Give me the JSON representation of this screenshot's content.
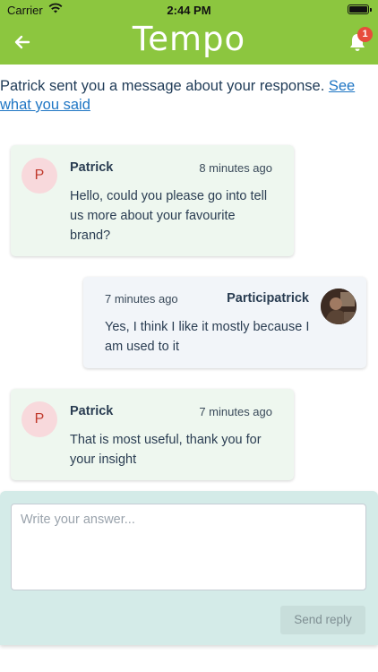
{
  "status_bar": {
    "carrier": "Carrier",
    "time": "2:44 PM"
  },
  "header": {
    "title": "Tempo",
    "notification_count": "1"
  },
  "notice": {
    "text": "Patrick sent you a message about your response. ",
    "link": "See what you said"
  },
  "messages": [
    {
      "initial": "P",
      "sender": "Patrick",
      "time": "8 minutes ago",
      "body": "Hello, could you please go into tell us more about your favourite brand?"
    },
    {
      "sender": "Participatrick",
      "time": "7 minutes ago",
      "body": "Yes, I think I like it mostly because I am used to it"
    },
    {
      "initial": "P",
      "sender": "Patrick",
      "time": "7 minutes ago",
      "body": "That is most useful, thank you for your insight"
    }
  ],
  "composer": {
    "placeholder": "Write your answer...",
    "send_label": "Send reply"
  },
  "colors": {
    "brand": "#8cc63f",
    "badge": "#e74c3c",
    "link": "#1f76c4",
    "composer_bg": "#d4ebe8"
  }
}
